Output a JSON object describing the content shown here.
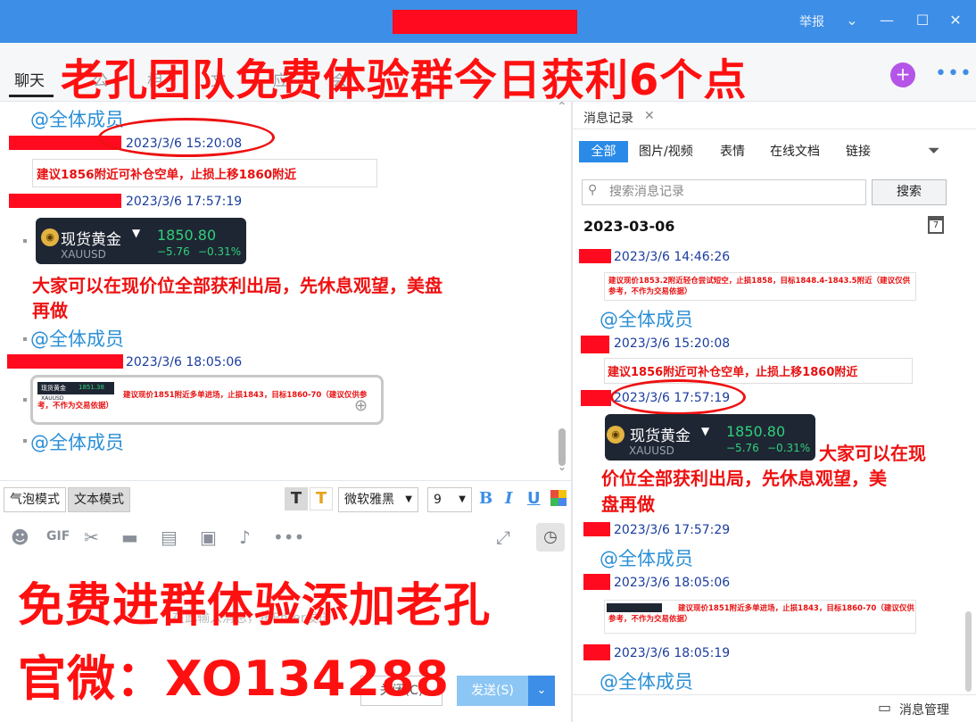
{
  "titlebar": {
    "report": "举报",
    "chevron": "chevron-down-icon",
    "minimize": "minimize-icon",
    "maximize": "maximize-icon",
    "close": "close-icon"
  },
  "tabs": {
    "chat": "聊天",
    "g1": "公",
    "g2": "相",
    "g3": "文",
    "g4": "应",
    "g5": "会"
  },
  "overlay": {
    "headline": "老孔团队免费体验群今日获利6个点",
    "join": "免费进群体验添加老孔",
    "wechat": "官微：XO134288"
  },
  "chat": {
    "mention": "@全体成员",
    "ts1": "2023/3/6 15:20:08",
    "msg1": "建议1856附近可补仓空单，止损上移1860附近",
    "ts2": "2023/3/6 17:57:19",
    "quote": {
      "name": "现货黄金",
      "symbol": "XAUUSD",
      "price": "1850.80",
      "change": "−5.76",
      "pct": "−0.31%"
    },
    "msg2_line1": "大家可以在现价位全部获利出局，先休息观望，美盘",
    "msg2_line2": "再做",
    "ts3": "2023/3/6 18:05:06",
    "img_msg": "建议现价1851附近多单进场，止损1843，目标1860-70（建议仅供参考，不作为交易依据）",
    "img_mini_name": "现货黄金",
    "img_mini_price": "1851.38",
    "img_mini_symbol": "XAUUSD"
  },
  "toolbar": {
    "bubble_mode": "气泡模式",
    "text_mode": "文本模式",
    "font": "微软雅黑",
    "size": "9",
    "bold": "B",
    "italic": "I",
    "underline": "U"
  },
  "input": {
    "placeholder": "在此输入消息，按Enter发送",
    "close": "关闭(C)",
    "send": "发送(S)"
  },
  "history": {
    "tab": "消息记录",
    "filters": [
      "全部",
      "图片/视频",
      "表情",
      "在线文档",
      "链接"
    ],
    "search_placeholder": "搜索消息记录",
    "search_btn": "搜索",
    "date": "2023-03-06",
    "ts_a": "2023/3/6 14:46:26",
    "msg_a": "建议现价1853.2附近轻仓尝试短空，止损1858，目标1848.4-1843.5附近（建议仅供参考，不作为交易依据）",
    "ts_b": "2023/3/6 15:20:08",
    "msg_b": "建议1856附近可补仓空单，止损上移1860附近",
    "ts_c": "2023/3/6 17:57:19",
    "msg_c1": "大家可以在现",
    "msg_c2": "价位全部获利出局，先休息观望，美",
    "msg_c3": "盘再做",
    "ts_d": "2023/3/6 17:57:29",
    "ts_e": "2023/3/6 18:05:06",
    "msg_e": "建议现价1851附近多单进场，止损1843，目标1860-70（建议仅供参考，不作为交易依据）",
    "ts_f": "2023/3/6 18:05:19",
    "manage": "消息管理",
    "calendar_day": "7"
  }
}
